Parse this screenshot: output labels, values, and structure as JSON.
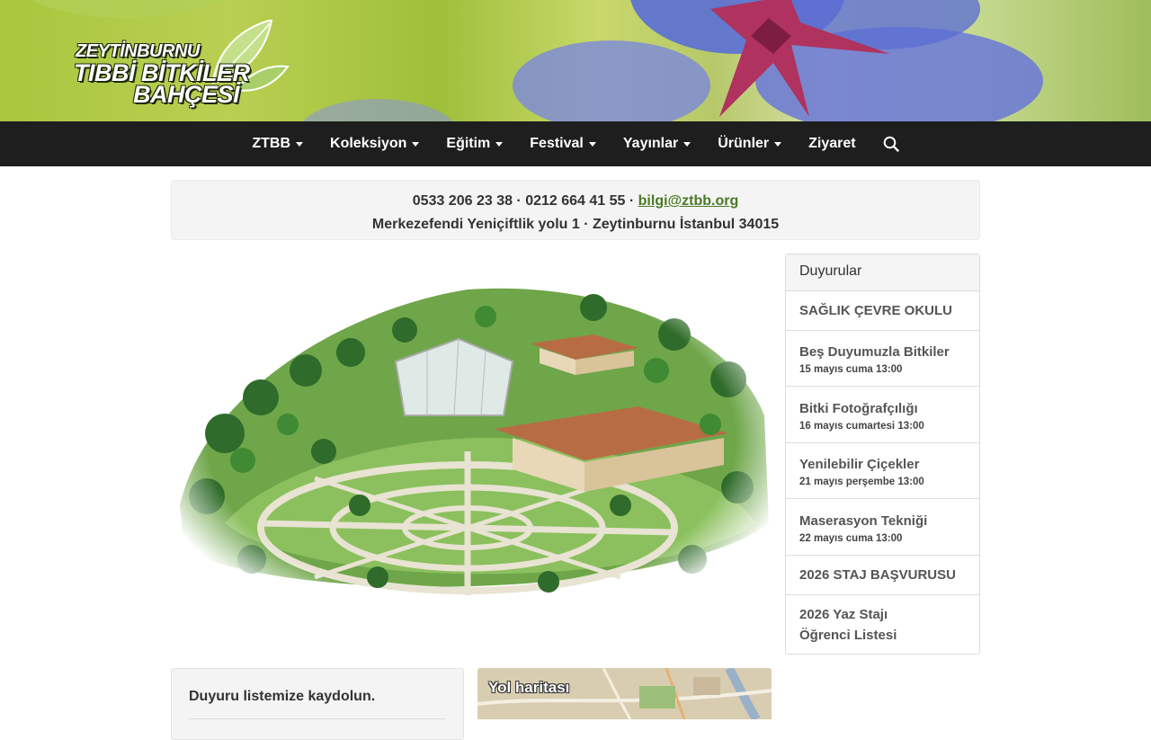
{
  "header": {
    "logo_line1": "ZEYTİNBURNU",
    "logo_line2": "TIBBİ BİTKİLER",
    "logo_line3": "BAHÇESİ"
  },
  "nav": {
    "items": [
      {
        "label": "ZTBB",
        "dropdown": true
      },
      {
        "label": "Koleksiyon",
        "dropdown": true
      },
      {
        "label": "Eğitim",
        "dropdown": true
      },
      {
        "label": "Festival",
        "dropdown": true
      },
      {
        "label": "Yayınlar",
        "dropdown": true
      },
      {
        "label": "Ürünler",
        "dropdown": true
      },
      {
        "label": "Ziyaret",
        "dropdown": false
      }
    ],
    "search_icon": "search-icon"
  },
  "contact": {
    "phones": "0533 206 23 38 · 0212 664 41 55 ·",
    "email": "bilgi@ztbb.org",
    "address": "Merkezefendi Yeniçiftlik yolu 1 · Zeytinburnu İstanbul 34015"
  },
  "sidebar": {
    "title": "Duyurular",
    "items": [
      {
        "title": "SAĞLIK ÇEVRE OKULU",
        "date": ""
      },
      {
        "title": "Beş Duyumuzla Bitkiler",
        "date": "15 mayıs cuma 13:00"
      },
      {
        "title": "Bitki Fotoğrafçılığı",
        "date": "16 mayıs cumartesi 13:00"
      },
      {
        "title": "Yenilebilir Çiçekler",
        "date": "21 mayıs perşembe 13:00"
      },
      {
        "title": "Maserasyon Tekniği",
        "date": "22 mayıs cuma 13:00"
      },
      {
        "title": "2026 STAJ BAŞVURUSU",
        "date": ""
      },
      {
        "title": "2026 Yaz Stajı Öğrenci Listesi",
        "date": ""
      }
    ]
  },
  "subscribe": {
    "title": "Duyuru listemize kaydolun."
  },
  "map": {
    "label": "Yol haritası"
  },
  "colors": {
    "navbar": "#1e1e1e",
    "link": "#4b7a25",
    "well": "#f4f4f4"
  }
}
